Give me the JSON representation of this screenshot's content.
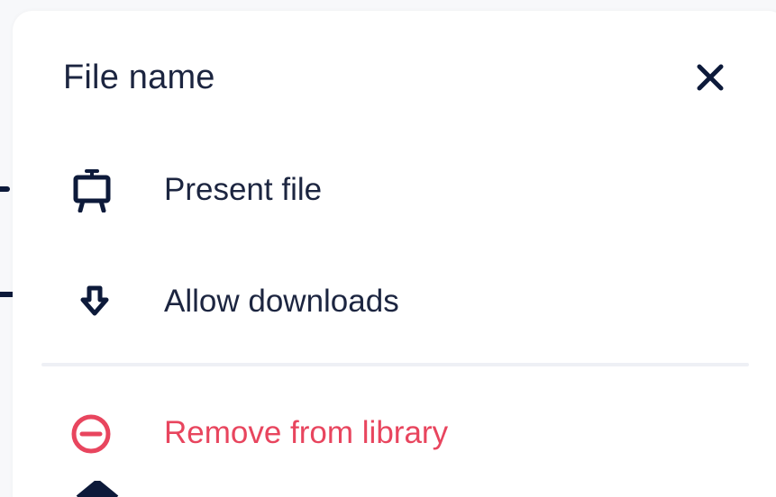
{
  "menu": {
    "title": "File name",
    "items": [
      {
        "label": "Present file",
        "icon": "presentation-easel-icon"
      },
      {
        "label": "Allow downloads",
        "icon": "download-arrow-icon"
      },
      {
        "label": "Remove from library",
        "icon": "remove-circle-icon"
      }
    ],
    "close_icon": "close-icon"
  },
  "colors": {
    "text": "#1c2540",
    "danger": "#e8455e",
    "divider": "#eef0f5",
    "background": "#f7f8fa",
    "panel": "#ffffff"
  }
}
